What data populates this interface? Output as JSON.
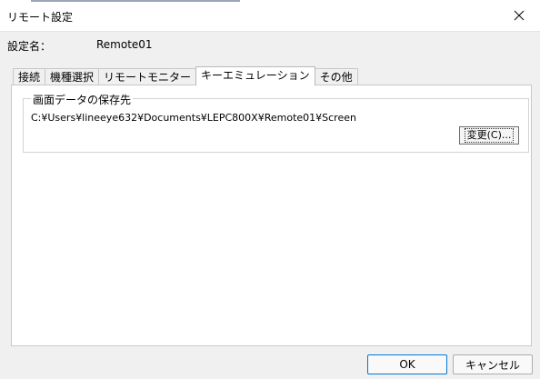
{
  "window": {
    "title": "リモート設定",
    "close_icon": "×"
  },
  "setting_name": {
    "label": "設定名：",
    "value": "Remote01"
  },
  "tabs": [
    {
      "label": "接続",
      "active": false
    },
    {
      "label": "機種選択",
      "active": false
    },
    {
      "label": "リモートモニター",
      "active": false
    },
    {
      "label": "キーエミュレーション",
      "active": true
    },
    {
      "label": "その他",
      "active": false
    }
  ],
  "screen_save": {
    "group_title": "画面データの保存先",
    "path": "C:¥Users¥lineeye632¥Documents¥LEPC800X¥Remote01¥Screen",
    "change_button": "変更(C)..."
  },
  "footer": {
    "ok": "OK",
    "cancel": "キャンセル"
  },
  "colors": {
    "accent": "#0078d4",
    "dialog_bg": "#f0f0f0",
    "panel_bg": "#ffffff"
  }
}
